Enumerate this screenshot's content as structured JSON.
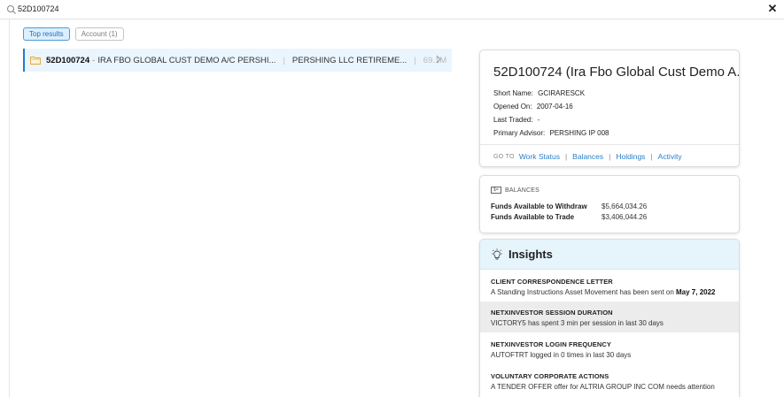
{
  "search": {
    "query": "52D100724"
  },
  "filters": [
    {
      "label": "Top results",
      "active": true
    },
    {
      "label": "Account (1)",
      "active": false
    }
  ],
  "result": {
    "account": "52D100724",
    "separator": "-",
    "description": "IRA FBO GLOBAL CUST DEMO A/C PERSHI...",
    "firm": "PERSHING LLC RETIREME...",
    "amount": "69.1M"
  },
  "account_card": {
    "title": "52D100724 (Ira Fbo Global Cust Demo A...",
    "short_name_label": "Short Name:",
    "short_name": "GCIRARESCK",
    "opened_label": "Opened On:",
    "opened": "2007-04-16",
    "last_traded_label": "Last Traded:",
    "last_traded": "-",
    "advisor_label": "Primary Advisor:",
    "advisor": "PERSHING IP 008",
    "goto_label": "GO TO",
    "links": [
      "Work Status",
      "Balances",
      "Holdings",
      "Activity"
    ]
  },
  "balances": {
    "header": "BALANCES",
    "withdraw_label": "Funds Available to Withdraw",
    "withdraw_value": "$5,664,034.26",
    "trade_label": "Funds Available to Trade",
    "trade_value": "$3,406,044.26"
  },
  "insights": {
    "title": "Insights",
    "items": [
      {
        "heading": "CLIENT CORRESPONDENCE LETTER",
        "body": "A Standing Instructions Asset Movement has been sent on ",
        "emphasis": "May 7, 2022"
      },
      {
        "heading": "NETXINVESTOR SESSION DURATION",
        "body": "VICTORY5 has spent 3 min per session in last 30 days",
        "emphasis": ""
      },
      {
        "heading": "NETXINVESTOR LOGIN FREQUENCY",
        "body": "AUTOFTRT logged in 0 times in last 30 days",
        "emphasis": ""
      },
      {
        "heading": "VOLUNTARY CORPORATE ACTIONS",
        "body": "A TENDER OFFER offer for ALTRIA GROUP INC COM needs attention",
        "emphasis": ""
      }
    ]
  },
  "colors": {
    "accent": "#1f7ad0",
    "link": "#2a7fc9",
    "selected_row": "#eaf5fe",
    "insights_header": "#e6f4fb"
  }
}
